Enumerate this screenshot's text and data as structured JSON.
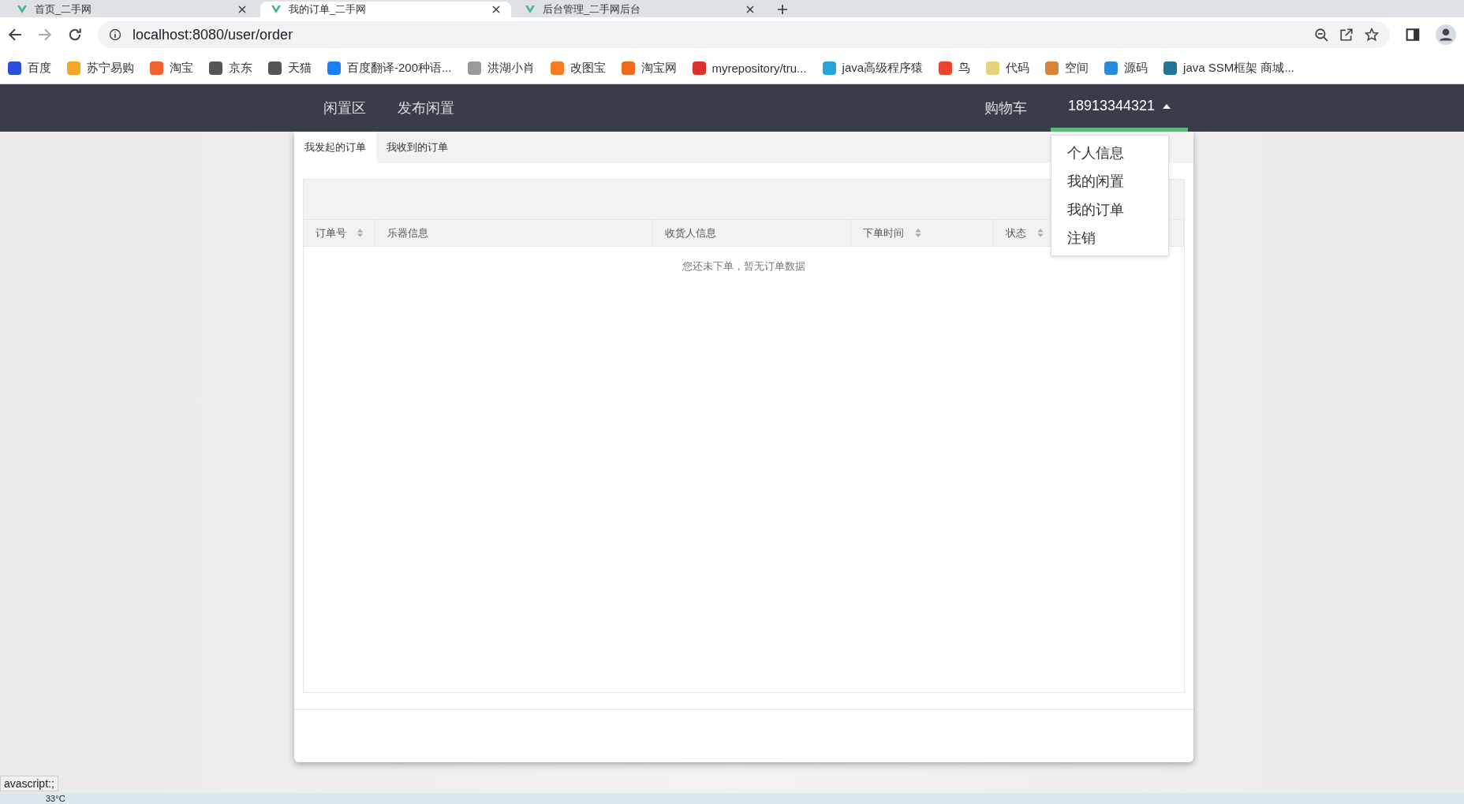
{
  "browser_tabs": [
    {
      "title": "首页_二手网",
      "selected": false
    },
    {
      "title": "我的订单_二手网",
      "selected": true
    },
    {
      "title": "后台管理_二手网后台",
      "selected": false
    }
  ],
  "address": "localhost:8080/user/order",
  "bookmarks": [
    {
      "label": "百度",
      "color": "#2b4fd8"
    },
    {
      "label": "苏宁易购",
      "color": "#f5a623"
    },
    {
      "label": "淘宝",
      "color": "#f0622d"
    },
    {
      "label": "京东",
      "color": "#555555"
    },
    {
      "label": "天猫",
      "color": "#555555"
    },
    {
      "label": "百度翻译-200种语...",
      "color": "#1a7ef5"
    },
    {
      "label": "洪湖小肖",
      "color": "#9a9a9a"
    },
    {
      "label": "改图宝",
      "color": "#f57c1f"
    },
    {
      "label": "淘宝网",
      "color": "#f06a1d"
    },
    {
      "label": "myrepository/tru...",
      "color": "#d9342b"
    },
    {
      "label": "java高级程序猿",
      "color": "#27a3d8"
    },
    {
      "label": "鸟",
      "color": "#e8452f"
    },
    {
      "label": "代码",
      "color": "#e8d27a"
    },
    {
      "label": "空间",
      "color": "#d9823a"
    },
    {
      "label": "源码",
      "color": "#2b8bd8"
    },
    {
      "label": "java SSM框架 商城...",
      "color": "#21759b"
    }
  ],
  "nav": {
    "left": [
      "闲置区",
      "发布闲置"
    ],
    "cart": "购物车",
    "user": "18913344321",
    "menu_open": true,
    "menu": [
      "个人信息",
      "我的闲置",
      "我的订单",
      "注销"
    ]
  },
  "order_tabs": [
    {
      "label": "我发起的订单",
      "selected": true
    },
    {
      "label": "我收到的订单",
      "selected": false
    }
  ],
  "table": {
    "columns": [
      {
        "label": "订单号",
        "sortable": true
      },
      {
        "label": "乐器信息",
        "sortable": false
      },
      {
        "label": "收货人信息",
        "sortable": false
      },
      {
        "label": "下单时间",
        "sortable": true
      },
      {
        "label": "状态",
        "sortable": true
      }
    ],
    "empty_text": "您还未下单，暂无订单数据"
  },
  "status_link": "avascript:;",
  "taskbar": {
    "weather": "33°C"
  }
}
